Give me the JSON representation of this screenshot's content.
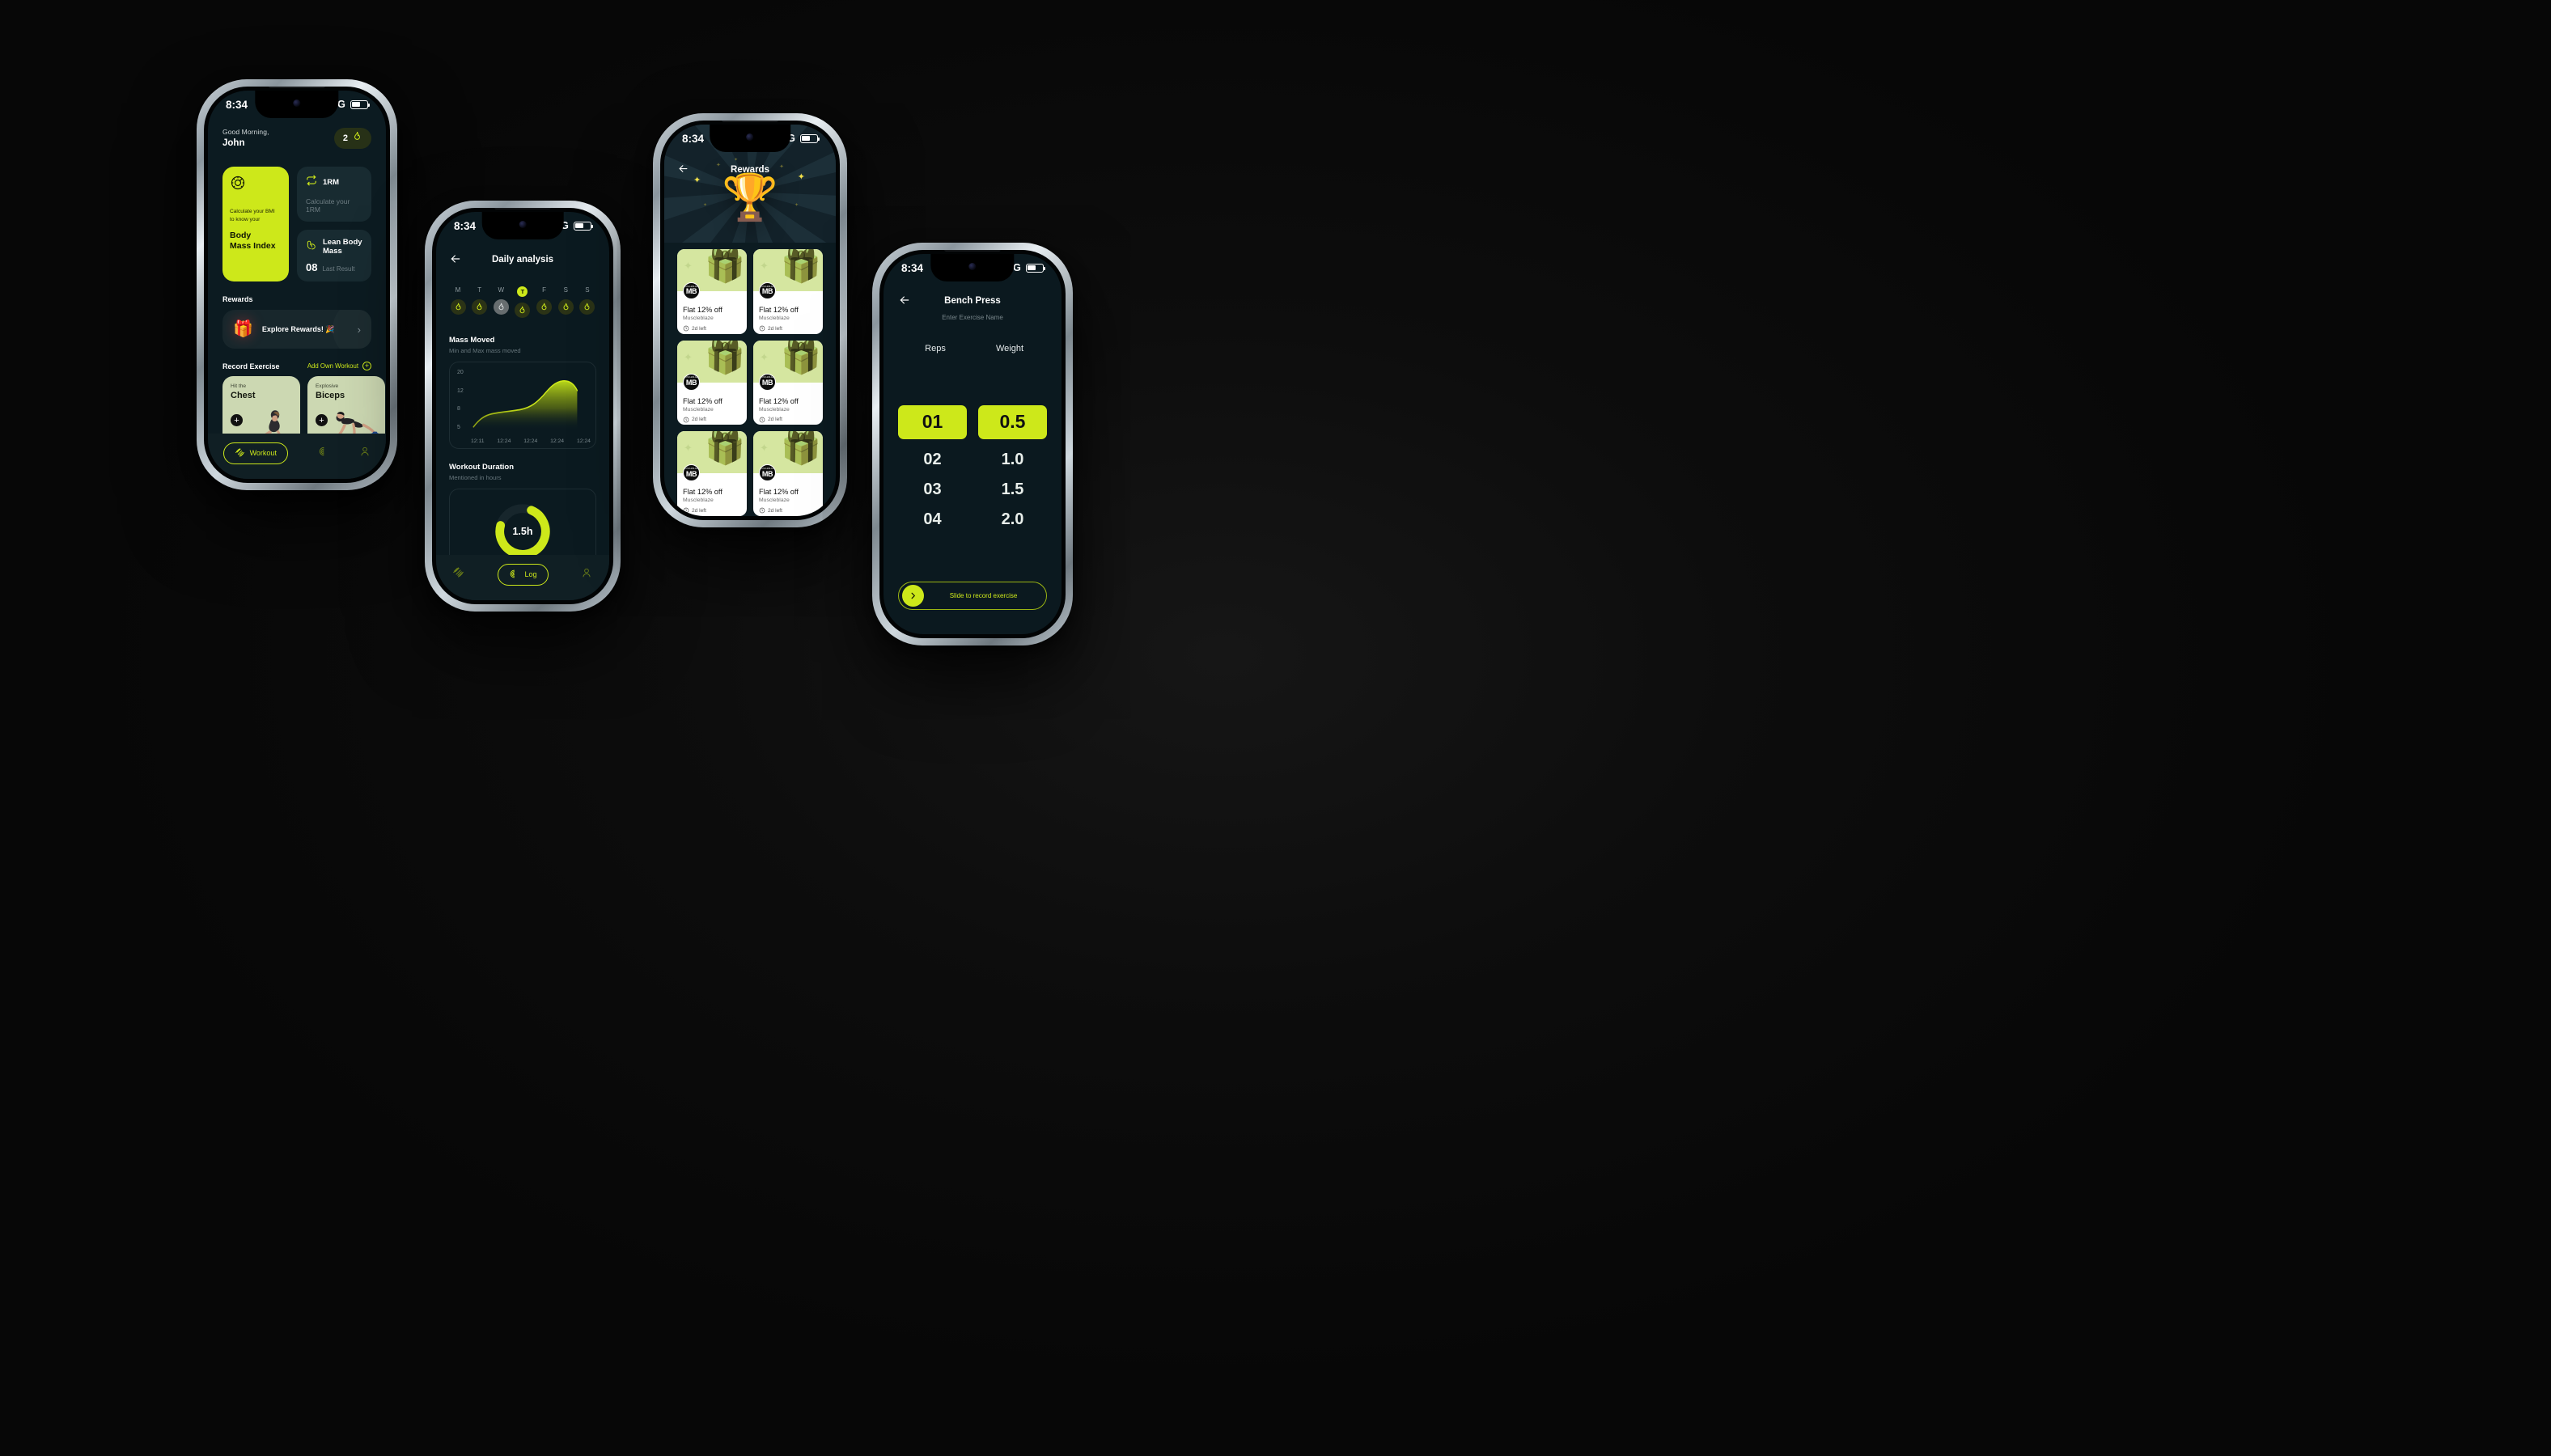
{
  "statusbar": {
    "time": "8:34",
    "network": "4G"
  },
  "phone1": {
    "greeting": "Good Morning,",
    "user_name": "John",
    "streak_count": "2",
    "streak_icon": "flame-icon",
    "bmi_card": {
      "icon": "bmi-gauge-icon",
      "line1": "Calculate your BMI",
      "line2": "to know your",
      "title_line1": "Body",
      "title_line2": "Mass Index"
    },
    "onerm_card": {
      "icon": "repeat-one-icon",
      "title": "1RM",
      "subtitle": "Calculate your 1RM"
    },
    "lbm_card": {
      "icon": "biceps-icon",
      "title": "Lean Body Mass",
      "value": "08",
      "label": "Last Result"
    },
    "rewards_section_title": "Rewards",
    "rewards_banner": {
      "icon": "gift-icon",
      "label": "Explore Rewards! 🎉",
      "chevron": "›"
    },
    "record_section_title": "Record Exercise",
    "add_own_workout": "Add Own Workout",
    "exercises": [
      {
        "kicker": "Hit the",
        "name": "Chest"
      },
      {
        "kicker": "Explosive",
        "name": "Biceps"
      }
    ],
    "tabs": [
      {
        "label": "Workout",
        "icon": "dumbbell-icon",
        "active": true
      },
      {
        "label": "",
        "icon": "log-icon",
        "active": false
      },
      {
        "label": "",
        "icon": "profile-icon",
        "active": false
      }
    ]
  },
  "phone2": {
    "nav_title": "Daily analysis",
    "back_icon": "arrow-left-icon",
    "days": [
      {
        "label": "M",
        "active": false,
        "flame": "on"
      },
      {
        "label": "T",
        "active": false,
        "flame": "on"
      },
      {
        "label": "W",
        "active": false,
        "flame": "off"
      },
      {
        "label": "T",
        "active": true,
        "flame": "on"
      },
      {
        "label": "F",
        "active": false,
        "flame": "on"
      },
      {
        "label": "S",
        "active": false,
        "flame": "on"
      },
      {
        "label": "S",
        "active": false,
        "flame": "on"
      }
    ],
    "mass_moved": {
      "title": "Mass Moved",
      "subtitle": "Min and Max mass moved"
    },
    "workout_duration": {
      "title": "Workout Duration",
      "subtitle": "Mentioned in hours",
      "value": "1.5h"
    },
    "tabs": [
      {
        "label": "",
        "icon": "dumbbell-icon",
        "active": false
      },
      {
        "label": "Log",
        "icon": "log-icon",
        "active": true
      },
      {
        "label": "",
        "icon": "profile-icon",
        "active": false
      }
    ]
  },
  "phone3": {
    "nav_title": "Rewards",
    "back_icon": "arrow-left-icon",
    "hero_icon": "trophy-icon",
    "cards": [
      {
        "title": "Flat 12% off",
        "brand": "Muscleblaze",
        "expiry": "2d left",
        "logo": "MB"
      },
      {
        "title": "Flat 12% off",
        "brand": "Muscleblaze",
        "expiry": "2d left",
        "logo": "MB"
      },
      {
        "title": "Flat 12% off",
        "brand": "Muscleblaze",
        "expiry": "2d left",
        "logo": "MB"
      },
      {
        "title": "Flat 12% off",
        "brand": "Muscleblaze",
        "expiry": "2d left",
        "logo": "MB"
      },
      {
        "title": "Flat 12% off",
        "brand": "Muscleblaze",
        "expiry": "2d left",
        "logo": "MB"
      },
      {
        "title": "Flat 12% off",
        "brand": "Muscleblaze",
        "expiry": "2d left",
        "logo": "MB"
      }
    ]
  },
  "phone4": {
    "nav_title": "Bench Press",
    "nav_subtitle": "Enter Exercise Name",
    "back_icon": "arrow-left-icon",
    "col_reps": "Reps",
    "col_weight": "Weight",
    "reps": {
      "selected": "01",
      "options": [
        "02",
        "03",
        "04"
      ]
    },
    "weight": {
      "selected": "0.5",
      "options": [
        "1.0",
        "1.5",
        "2.0"
      ]
    },
    "slide": {
      "label": "Slide to record exercise",
      "knob_icon": "chevron-right-icon"
    }
  },
  "chart_data": {
    "type": "area",
    "title": "Mass Moved",
    "subtitle": "Min and Max mass moved",
    "xlabel": "",
    "ylabel": "",
    "ylim": [
      5,
      20
    ],
    "yticks": [
      20,
      12,
      8,
      5
    ],
    "x": [
      "12:11",
      "12:24",
      "12:24",
      "12:24",
      "12:24"
    ],
    "values": [
      5.0,
      6.6,
      7.1,
      7.4,
      8.2,
      10.4,
      11.8,
      11.9,
      10.3
    ],
    "grid": false,
    "legend": "none",
    "line_color": "#cde81a",
    "fill": "gradient-olive-to-transparent"
  }
}
